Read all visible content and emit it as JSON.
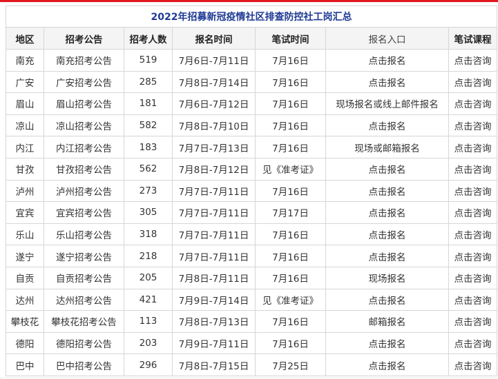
{
  "title": "2022年招募新冠疫情社区排查防控社工岗汇总",
  "headers": {
    "region": "地区",
    "notice": "招考公告",
    "count": "招考人数",
    "reg_time": "报名时间",
    "exam_time": "笔试时间",
    "entry": "报名入口",
    "course": "笔试课程"
  },
  "rows": [
    {
      "region": "南充",
      "notice": "南充招考公告",
      "count": "519",
      "reg_time": "7月6日-7月11日",
      "exam_time": "7月16日",
      "entry": "点击报名",
      "course": "点击咨询"
    },
    {
      "region": "广安",
      "notice": "广安招考公告",
      "count": "285",
      "reg_time": "7月8日-7月14日",
      "exam_time": "7月16日",
      "entry": "点击报名",
      "course": "点击咨询"
    },
    {
      "region": "眉山",
      "notice": "眉山招考公告",
      "count": "181",
      "reg_time": "7月6日-7月12日",
      "exam_time": "7月16日",
      "entry": "现场报名或线上邮件报名",
      "course": "点击咨询"
    },
    {
      "region": "凉山",
      "notice": "凉山招考公告",
      "count": "582",
      "reg_time": "7月8日-7月10日",
      "exam_time": "7月16日",
      "entry": "点击报名",
      "course": "点击咨询"
    },
    {
      "region": "内江",
      "notice": "内江招考公告",
      "count": "183",
      "reg_time": "7月7日-7月13日",
      "exam_time": "7月16日",
      "entry": "现场或邮箱报名",
      "course": "点击咨询"
    },
    {
      "region": "甘孜",
      "notice": "甘孜招考公告",
      "count": "562",
      "reg_time": "7月8日-7月12日",
      "exam_time": "见《准考证》",
      "entry": "点击报名",
      "course": "点击咨询"
    },
    {
      "region": "泸州",
      "notice": "泸州招考公告",
      "count": "273",
      "reg_time": "7月7日-7月11日",
      "exam_time": "7月16日",
      "entry": "点击报名",
      "course": "点击咨询"
    },
    {
      "region": "宜宾",
      "notice": "宜宾招考公告",
      "count": "305",
      "reg_time": "7月7日-7月11日",
      "exam_time": "7月17日",
      "entry": "点击报名",
      "course": "点击咨询"
    },
    {
      "region": "乐山",
      "notice": "乐山招考公告",
      "count": "318",
      "reg_time": "7月7日-7月11日",
      "exam_time": "7月16日",
      "entry": "点击报名",
      "course": "点击咨询"
    },
    {
      "region": "遂宁",
      "notice": "遂宁招考公告",
      "count": "218",
      "reg_time": "7月7日-7月11日",
      "exam_time": "7月16日",
      "entry": "点击报名",
      "course": "点击咨询"
    },
    {
      "region": "自贡",
      "notice": "自贡招考公告",
      "count": "205",
      "reg_time": "7月8日-7月11日",
      "exam_time": "7月16日",
      "entry": "现场报名",
      "course": "点击咨询"
    },
    {
      "region": "达州",
      "notice": "达州招考公告",
      "count": "421",
      "reg_time": "7月9日-7月14日",
      "exam_time": "见《准考证》",
      "entry": "点击报名",
      "course": "点击咨询"
    },
    {
      "region": "攀枝花",
      "notice": "攀枝花招考公告",
      "count": "113",
      "reg_time": "7月8日-7月13日",
      "exam_time": "7月16日",
      "entry": "邮箱报名",
      "course": "点击咨询"
    },
    {
      "region": "德阳",
      "notice": "德阳招考公告",
      "count": "203",
      "reg_time": "7月9日-7月11日",
      "exam_time": "7月16日",
      "entry": "点击报名",
      "course": "点击咨询"
    },
    {
      "region": "巴中",
      "notice": "巴中招考公告",
      "count": "296",
      "reg_time": "7月8日-7月15日",
      "exam_time": "7月25日",
      "entry": "点击报名",
      "course": "点击咨询"
    }
  ]
}
